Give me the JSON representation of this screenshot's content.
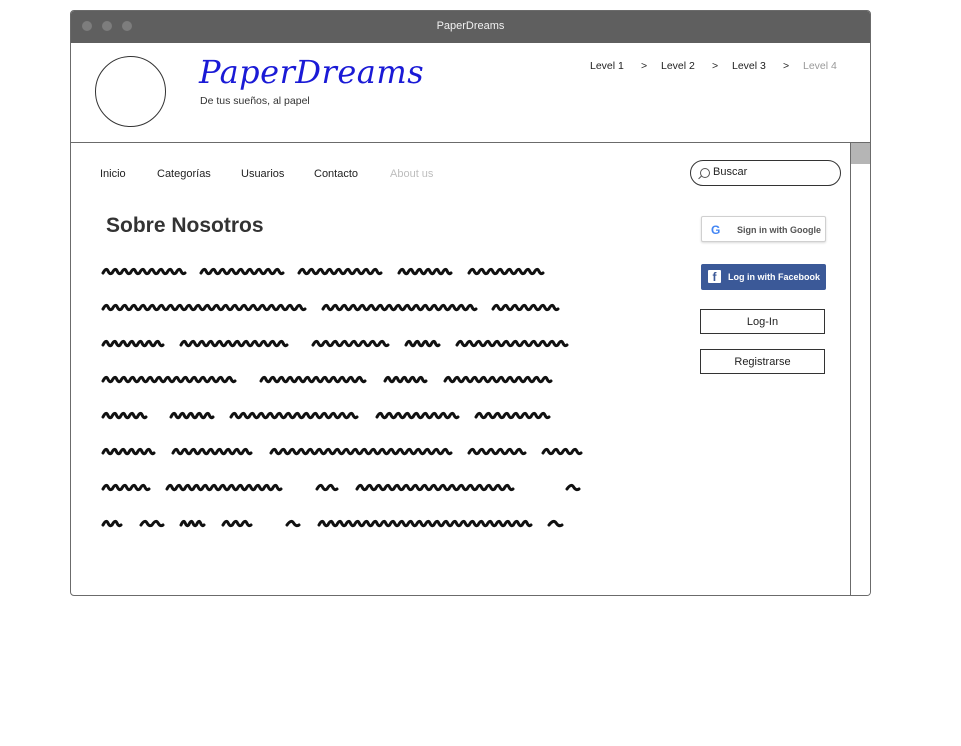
{
  "window": {
    "title": "PaperDreams"
  },
  "header": {
    "brand": "PaperDreams",
    "tagline": "De tus sueños, al papel",
    "breadcrumb": [
      {
        "label": "Level 1",
        "current": false
      },
      {
        "label": "Level 2",
        "current": false
      },
      {
        "label": "Level 3",
        "current": false
      },
      {
        "label": "Level 4",
        "current": true
      }
    ],
    "breadcrumb_separator": ">"
  },
  "nav": {
    "items": [
      {
        "label": "Inicio",
        "disabled": false
      },
      {
        "label": "Categorías",
        "disabled": false
      },
      {
        "label": "Usuarios",
        "disabled": false
      },
      {
        "label": "Contacto",
        "disabled": false
      },
      {
        "label": "About us",
        "disabled": true
      }
    ]
  },
  "search": {
    "placeholder": "Buscar",
    "icon": "search-icon"
  },
  "main": {
    "title": "Sobre Nosotros"
  },
  "auth": {
    "google_label": "Sign in with Google",
    "facebook_label": "Log in with Facebook",
    "login_label": "Log-In",
    "register_label": "Registrarse"
  },
  "colors": {
    "brand": "#1a1ad6",
    "facebook": "#3b5998",
    "titlebar": "#5f5f5f"
  }
}
